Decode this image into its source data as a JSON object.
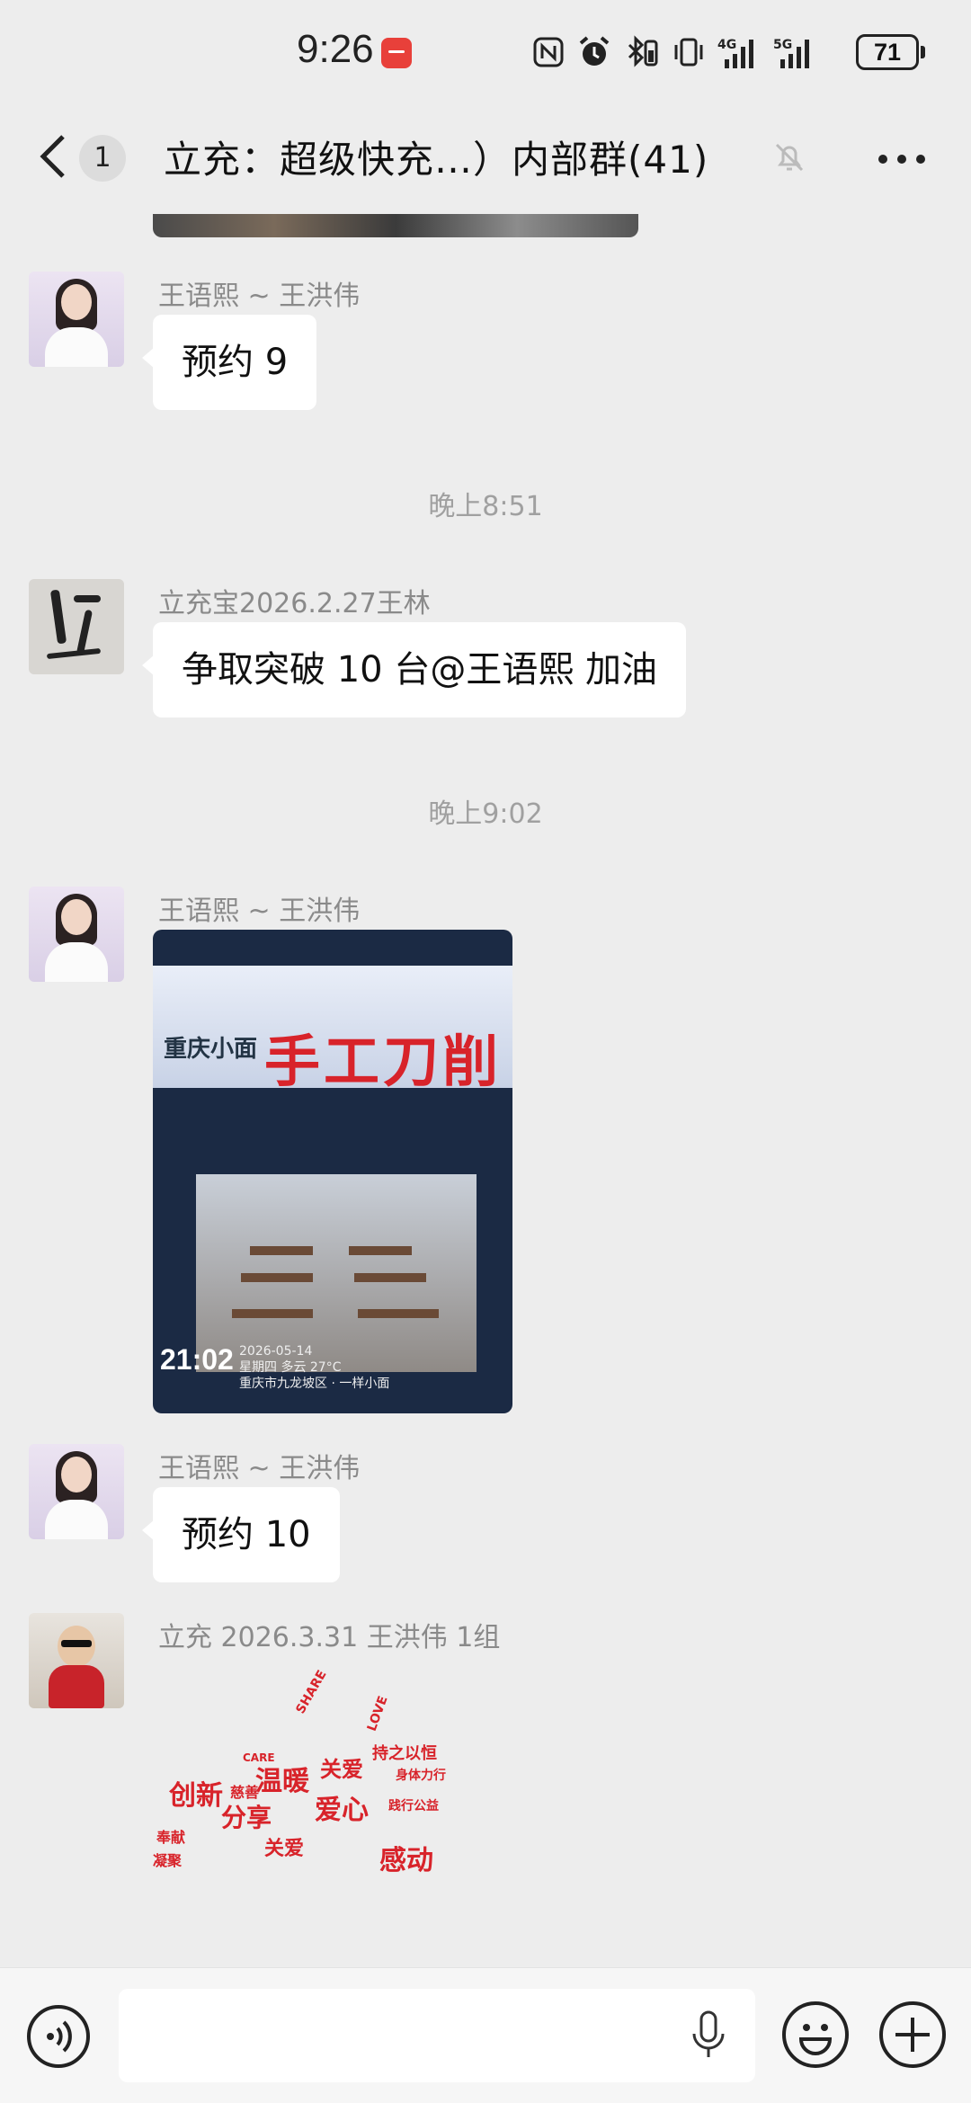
{
  "status_bar": {
    "time": "9:26",
    "battery": "71",
    "icons": [
      "nfc-icon",
      "alarm-icon",
      "bluetooth-icon",
      "vibrate-icon",
      "4g-signal-icon",
      "5g-signal-icon"
    ]
  },
  "header": {
    "unread_count": "1",
    "title": "立充：超级快充…）内部群(41)"
  },
  "messages": [
    {
      "type": "text",
      "sender": "王语熙 ~ 王洪伟",
      "text": "预约 9"
    },
    {
      "type": "time",
      "text": "晚上8:51"
    },
    {
      "type": "text",
      "sender": "立充宝2026.2.27王林",
      "text": "争取突破 10 台@王语熙  加油"
    },
    {
      "type": "time",
      "text": "晚上9:02"
    },
    {
      "type": "image",
      "sender": "王语熙 ~ 王洪伟",
      "sign_small": "重庆小面",
      "sign_big": "手工刀削",
      "stamp_time": "21:02",
      "stamp_date": "2026-05-14",
      "stamp_weekday": "星期四",
      "stamp_weather": "多云 27°C",
      "stamp_location": "重庆市九龙坡区 · 一样小面"
    },
    {
      "type": "text",
      "sender": "王语熙 ~ 王洪伟",
      "text": "预约 10"
    },
    {
      "type": "sticker",
      "sender": "立充 2026.3.31 王洪伟 1组",
      "words": [
        "创新",
        "温暖",
        "关爱",
        "爱心",
        "分享",
        "感动",
        "持之以恒",
        "身体力行",
        "践行公益",
        "凝聚",
        "奉献",
        "关爱",
        "慈善",
        "LOVE",
        "SHARE",
        "CARE"
      ]
    }
  ],
  "colors": {
    "background": "#ededed",
    "bubble": "#ffffff",
    "accent_red": "#d8232a"
  }
}
